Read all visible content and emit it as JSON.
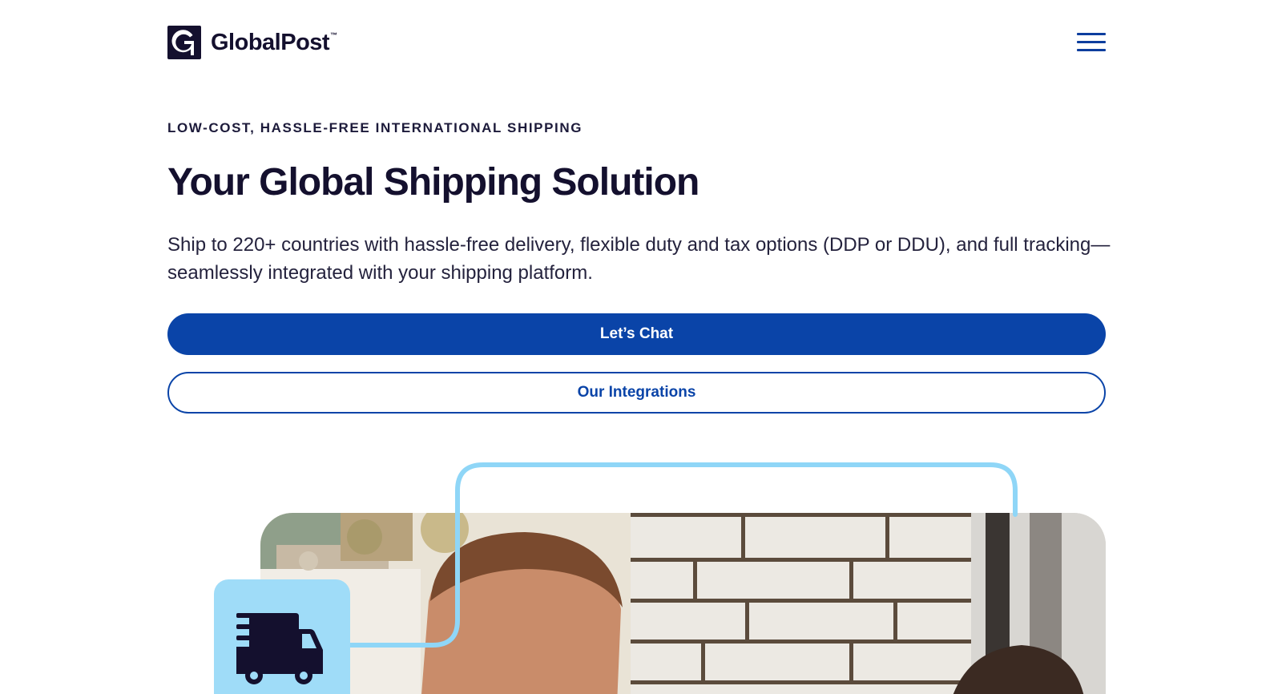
{
  "brand": {
    "name": "GlobalPost",
    "trademark": "™",
    "logo_letter": "G"
  },
  "header": {
    "menu_icon": "hamburger-menu-icon"
  },
  "hero": {
    "eyebrow": "LOW-COST, HASSLE-FREE INTERNATIONAL SHIPPING",
    "title": "Your Global Shipping Solution",
    "description": "Ship to 220+ countries with hassle-free delivery, flexible duty and tax options (DDP or DDU), and full tracking—seamlessly integrated with your shipping platform.",
    "primary_button": "Let’s Chat",
    "secondary_button": "Our Integrations"
  },
  "visual": {
    "card_icon": "delivery-truck-icon",
    "photo_subject": "delivery-person-photo"
  },
  "colors": {
    "brand_navy": "#14102e",
    "accent_blue": "#0a44a8",
    "light_blue": "#9fdcf8",
    "route_line": "#8fd6f7"
  }
}
